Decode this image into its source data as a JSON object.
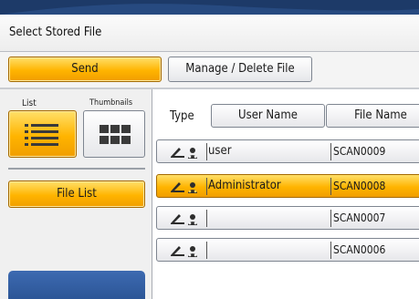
{
  "window": {
    "title": "Select Stored File"
  },
  "toolbar": {
    "send_label": "Send",
    "manage_label": "Manage / Delete File"
  },
  "view_toggle": {
    "list_label": "List",
    "thumbnails_label": "Thumbnails",
    "selected": "List"
  },
  "sidebar": {
    "file_list_label": "File List"
  },
  "table": {
    "type_label": "Type",
    "columns": [
      "User Name",
      "File Name"
    ],
    "rows": [
      {
        "user": "user",
        "file": "SCAN0009",
        "selected": false,
        "icons": [
          "scanner-icon",
          "user-icon"
        ]
      },
      {
        "user": "Administrator",
        "file": "SCAN0008",
        "selected": true,
        "icons": [
          "scanner-icon",
          "user-icon"
        ]
      },
      {
        "user": "",
        "file": "SCAN0007",
        "selected": false,
        "icons": [
          "scanner-icon",
          "user-icon"
        ]
      },
      {
        "user": "",
        "file": "SCAN0006",
        "selected": false,
        "icons": [
          "scanner-icon",
          "user-icon"
        ]
      }
    ]
  },
  "colors": {
    "accent": "#ffb400",
    "header": "#1f3d6c",
    "panel_blue": "#2f5a9e"
  }
}
